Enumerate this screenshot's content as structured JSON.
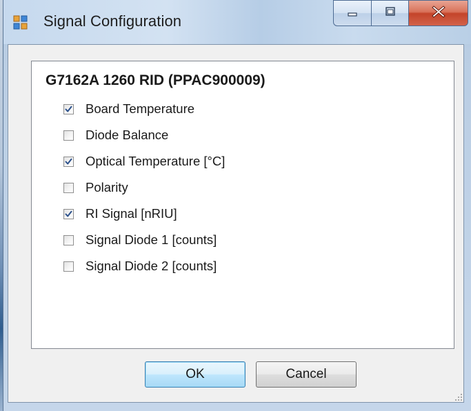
{
  "window": {
    "title": "Signal Configuration",
    "icon": "app-form-icon",
    "caption_buttons": [
      "minimize",
      "maximize",
      "close"
    ]
  },
  "group": {
    "title": "G7162A 1260 RID (PPAC900009)"
  },
  "signals": [
    {
      "label": "Board Temperature",
      "checked": true
    },
    {
      "label": "Diode Balance",
      "checked": false
    },
    {
      "label": "Optical Temperature [°C]",
      "checked": true
    },
    {
      "label": "Polarity",
      "checked": false
    },
    {
      "label": "RI Signal [nRIU]",
      "checked": true
    },
    {
      "label": "Signal Diode 1 [counts]",
      "checked": false
    },
    {
      "label": "Signal Diode 2 [counts]",
      "checked": false
    }
  ],
  "buttons": {
    "ok_label": "OK",
    "cancel_label": "Cancel"
  },
  "colors": {
    "title_bar": "#c6d9ee",
    "close_button": "#c4442a",
    "check_mark": "#2a4f8a",
    "default_button_border": "#3c7fb1"
  }
}
